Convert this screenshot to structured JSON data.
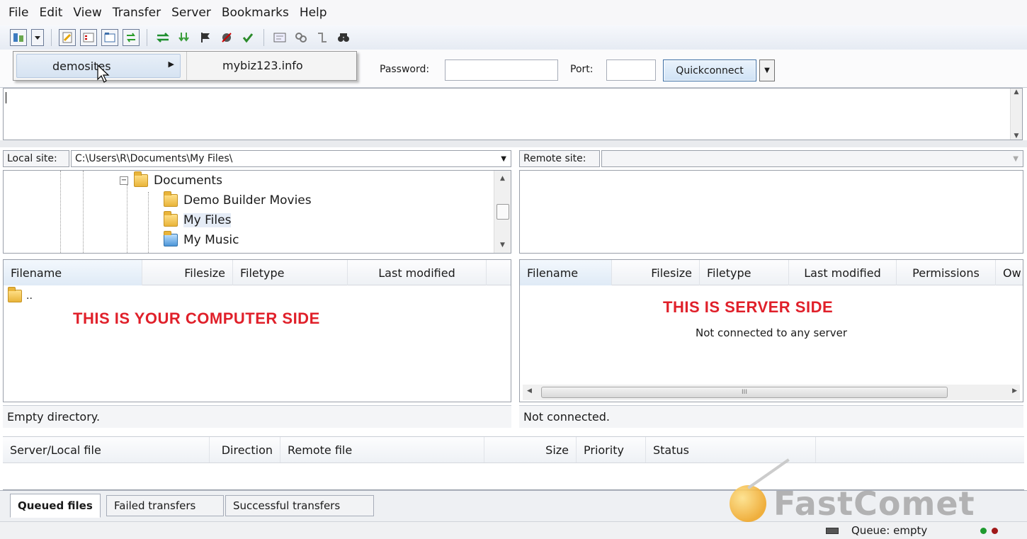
{
  "menubar": {
    "items": [
      "File",
      "Edit",
      "View",
      "Transfer",
      "Server",
      "Bookmarks",
      "Help"
    ]
  },
  "toolbar": {
    "icons": [
      "site-manager-icon",
      "dropdown-arrow-icon",
      "toggle-log-icon",
      "toggle-local-tree-icon",
      "toggle-remote-tree-icon",
      "toggle-queue-icon",
      "refresh-icon",
      "process-queue-icon",
      "cancel-icon",
      "disconnect-icon",
      "reconnect-icon",
      "directory-listing-filters-icon",
      "compare-icon",
      "sync-browse-icon",
      "search-icon"
    ]
  },
  "quickconnect": {
    "password_label": "Password:",
    "password_value": "",
    "port_label": "Port:",
    "port_value": "",
    "button_label": "Quickconnect"
  },
  "dropdown": {
    "item_label": "demosites",
    "submenu_item": "mybiz123.info"
  },
  "local": {
    "label": "Local site:",
    "path": "C:\\Users\\R\\Documents\\My Files\\",
    "tree": [
      "Documents",
      "Demo Builder Movies",
      "My Files",
      "My Music"
    ],
    "columns": [
      "Filename",
      "Filesize",
      "Filetype",
      "Last modified"
    ],
    "rows": [
      ".."
    ],
    "annotation": "THIS IS YOUR COMPUTER SIDE",
    "status": "Empty directory."
  },
  "remote": {
    "label": "Remote site:",
    "path": "",
    "columns": [
      "Filename",
      "Filesize",
      "Filetype",
      "Last modified",
      "Permissions",
      "Ow"
    ],
    "annotation": "THIS IS SERVER SIDE",
    "message": "Not connected to any server",
    "scroll_marker": "III",
    "status": "Not connected."
  },
  "queue": {
    "columns": [
      "Server/Local file",
      "Direction",
      "Remote file",
      "Size",
      "Priority",
      "Status"
    ],
    "tabs": [
      "Queued files",
      "Failed transfers",
      "Successful transfers"
    ],
    "status": "Queue: empty"
  },
  "watermark": {
    "text": "FastComet"
  },
  "colors": {
    "annotation": "#e0202a",
    "button_border": "#3b6ea5",
    "watermark": "#a8a8a8"
  }
}
